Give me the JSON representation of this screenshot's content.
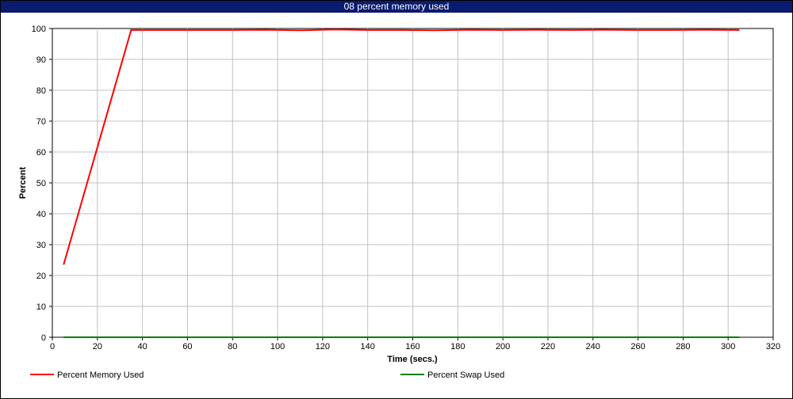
{
  "window": {
    "title": "08 percent memory used"
  },
  "chart_data": {
    "type": "line",
    "title": "08 percent memory used",
    "xlabel": "Time (secs.)",
    "ylabel": "Percent",
    "xlim": [
      0,
      320
    ],
    "ylim": [
      0,
      100
    ],
    "xticks": [
      0,
      20,
      40,
      60,
      80,
      100,
      120,
      140,
      160,
      180,
      200,
      220,
      240,
      260,
      280,
      300,
      320
    ],
    "yticks": [
      0,
      10,
      20,
      30,
      40,
      50,
      60,
      70,
      80,
      90,
      100
    ],
    "grid": true,
    "legend_position": "bottom",
    "series": [
      {
        "name": "Percent Memory Used",
        "color": "#ff0000",
        "x": [
          5,
          35,
          50,
          80,
          95,
          110,
          125,
          140,
          155,
          170,
          185,
          200,
          215,
          230,
          245,
          260,
          275,
          290,
          305
        ],
        "y": [
          23.5,
          99.5,
          99.5,
          99.5,
          99.6,
          99.4,
          99.7,
          99.5,
          99.5,
          99.4,
          99.6,
          99.5,
          99.6,
          99.5,
          99.6,
          99.5,
          99.5,
          99.6,
          99.5
        ]
      },
      {
        "name": "Percent Swap Used",
        "color": "#008000",
        "x": [
          5,
          35,
          50,
          80,
          95,
          110,
          125,
          140,
          155,
          170,
          185,
          200,
          215,
          230,
          245,
          260,
          275,
          290,
          305
        ],
        "y": [
          0,
          0,
          0,
          0,
          0,
          0,
          0,
          0,
          0,
          0,
          0,
          0,
          0,
          0,
          0,
          0,
          0,
          0,
          0
        ]
      }
    ]
  }
}
